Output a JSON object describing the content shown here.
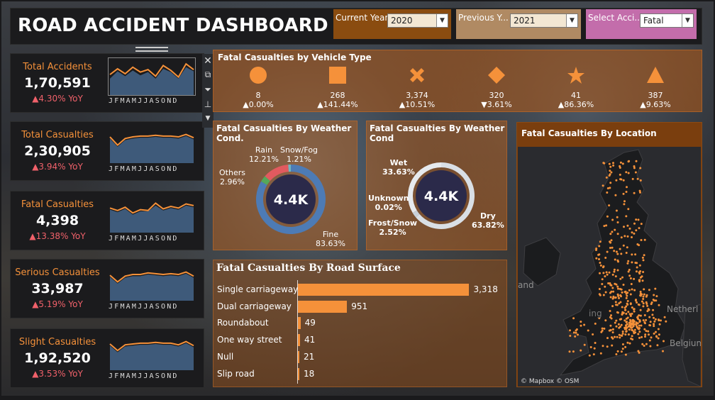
{
  "header": {
    "title": "ROAD ACCIDENT DASHBOARD"
  },
  "filters": {
    "current_label": "Current Year",
    "current_value": "2020",
    "previous_label": "Previous Y...",
    "previous_value": "2021",
    "select_label": "Select Acci...",
    "select_value": "Fatal"
  },
  "toolbar": {
    "close_icon": "close-icon",
    "open_icon": "external-link-icon",
    "filter_icon": "filter-icon",
    "pin_icon": "pin-icon",
    "more_icon": "chevron-down-icon"
  },
  "kpis": [
    {
      "label": "Total Accidents",
      "value": "1,70,591",
      "yoy": "▲4.30% YoY",
      "trend_current": [
        6.5,
        7.2,
        6.6,
        7.4,
        6.8,
        7.1,
        6.3,
        7.6,
        7.0,
        6.2,
        7.8,
        7.1
      ],
      "trend_previous": [
        6.0,
        6.9,
        6.3,
        7.0,
        6.4,
        6.8,
        6.0,
        7.2,
        6.8,
        6.0,
        7.4,
        6.9
      ]
    },
    {
      "label": "Total Casualties",
      "value": "2,30,905",
      "yoy": "▲3.94% YoY",
      "trend_current": [
        7.2,
        6.2,
        7.0,
        7.2,
        7.3,
        7.3,
        7.4,
        7.3,
        7.3,
        7.2,
        7.5,
        7.1
      ],
      "trend_previous": [
        7.0,
        6.0,
        6.8,
        7.0,
        7.1,
        7.1,
        7.2,
        7.1,
        7.1,
        7.0,
        7.3,
        6.9
      ]
    },
    {
      "label": "Fatal Casualties",
      "value": "4,398",
      "yoy": "▲13.38% YoY",
      "trend_current": [
        7.0,
        6.7,
        7.1,
        6.4,
        6.8,
        6.7,
        7.6,
        6.9,
        7.2,
        7.0,
        7.5,
        7.3
      ],
      "trend_previous": [
        6.8,
        6.5,
        6.9,
        6.2,
        6.6,
        6.6,
        7.3,
        6.7,
        7.0,
        6.8,
        7.3,
        7.1
      ]
    },
    {
      "label": "Serious Casualties",
      "value": "33,987",
      "yoy": "▲5.19% YoY",
      "trend_current": [
        7.1,
        6.3,
        7.0,
        7.2,
        7.2,
        7.4,
        7.3,
        7.2,
        7.3,
        7.2,
        7.5,
        7.0
      ],
      "trend_previous": [
        6.9,
        6.1,
        6.8,
        7.0,
        7.0,
        7.2,
        7.1,
        7.0,
        7.1,
        7.0,
        7.3,
        6.8
      ]
    },
    {
      "label": "Slight Casualties",
      "value": "1,92,520",
      "yoy": "▲3.53% YoY",
      "trend_current": [
        7.2,
        6.4,
        7.1,
        7.2,
        7.3,
        7.3,
        7.4,
        7.3,
        7.3,
        7.1,
        7.5,
        7.0
      ],
      "trend_previous": [
        7.0,
        6.2,
        6.9,
        7.0,
        7.1,
        7.1,
        7.2,
        7.1,
        7.1,
        6.9,
        7.3,
        6.8
      ]
    }
  ],
  "month_axis": "JFMAMJJASOND",
  "chart_data": [
    {
      "type": "table",
      "title": "Fatal Casualties by Vehicle Type",
      "items": [
        {
          "icon": "circle-icon",
          "count": "8",
          "change": "▲0.00%"
        },
        {
          "icon": "square-icon",
          "count": "268",
          "change": "▲141.44%"
        },
        {
          "icon": "cross-icon",
          "count": "3,374",
          "change": "▲10.51%"
        },
        {
          "icon": "diamond-icon",
          "count": "320",
          "change": "▼3.61%"
        },
        {
          "icon": "star-icon",
          "count": "41",
          "change": "▲86.36%"
        },
        {
          "icon": "triangle-icon",
          "count": "387",
          "change": "▲9.63%"
        }
      ]
    },
    {
      "type": "pie",
      "title": "Fatal Casualties By Weather Cond.",
      "center_label": "4.4K",
      "slices": [
        {
          "name": "Fine",
          "value": 83.63,
          "label": "Fine\n83.63%",
          "color": "#4d7bb5"
        },
        {
          "name": "Others",
          "value": 2.96,
          "label": "Others\n2.96%",
          "color": "#55a85a"
        },
        {
          "name": "Rain",
          "value": 12.21,
          "label": "Rain\n12.21%",
          "color": "#e15a5f"
        },
        {
          "name": "Snow/Fog",
          "value": 1.21,
          "label": "Snow/Fog\n1.21%",
          "color": "#6fb6c0"
        }
      ]
    },
    {
      "type": "pie",
      "title": "Fatal Casualties By Weather Cond",
      "center_label": "4.4K",
      "slices": [
        {
          "name": "Dry",
          "value": 63.82,
          "label": "Dry\n63.82%",
          "color": "#d9dfe5"
        },
        {
          "name": "Frost/Snow",
          "value": 2.52,
          "label": "Frost/Snow\n2.52%",
          "color": "#c8d1da"
        },
        {
          "name": "Unknown",
          "value": 0.02,
          "label": "Unknown\n0.02%",
          "color": "#b9c3cd"
        },
        {
          "name": "Wet",
          "value": 33.63,
          "label": "Wet\n33.63%",
          "color": "#e6eaee"
        }
      ]
    },
    {
      "type": "bar",
      "title": "Fatal Casualties By Road Surface",
      "categories": [
        "Single carriageway",
        "Dual carriageway",
        "Roundabout",
        "One way street",
        "Null",
        "Slip road"
      ],
      "values": [
        3318,
        951,
        49,
        41,
        21,
        18
      ],
      "value_labels": [
        "3,318",
        "951",
        "49",
        "41",
        "21",
        "18"
      ],
      "xlim": [
        0,
        3500
      ]
    }
  ],
  "map": {
    "title": "Fatal Casualties By Location",
    "labels": [
      "and",
      "Netherl",
      "Belgium",
      "ing"
    ],
    "credit": "© Mapbox © OSM"
  },
  "colors": {
    "accent": "#f5913a",
    "kpi_bg": "#1b1b1d",
    "area": "#3e5a7a",
    "negative": "#f0616a",
    "donut_center": "#2b2a4a"
  }
}
